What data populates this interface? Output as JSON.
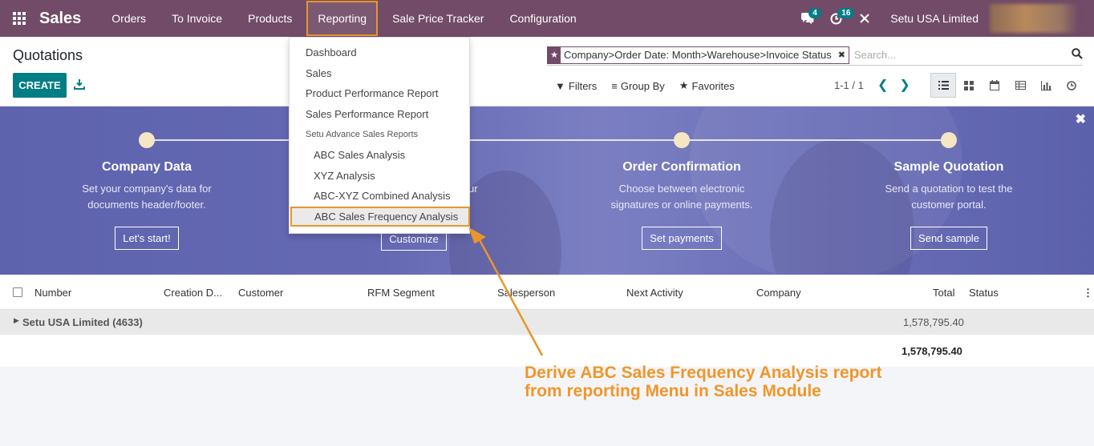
{
  "navbar": {
    "app_name": "Sales",
    "menu": [
      {
        "label": "Orders"
      },
      {
        "label": "To Invoice"
      },
      {
        "label": "Products"
      },
      {
        "label": "Reporting"
      },
      {
        "label": "Sale Price Tracker"
      },
      {
        "label": "Configuration"
      }
    ],
    "messages_count": "4",
    "activities_count": "16",
    "company": "Setu USA Limited"
  },
  "control_panel": {
    "title": "Quotations",
    "create_label": "CREATE",
    "search": {
      "facet": "Company>Order Date: Month>Warehouse>Invoice Status",
      "placeholder": "Search..."
    },
    "filters_label": "Filters",
    "groupby_label": "Group By",
    "favorites_label": "Favorites",
    "pager": "1-1 / 1"
  },
  "banner": {
    "steps": [
      {
        "title": "Company Data",
        "desc_line1": "Set your company's data for",
        "desc_line2": "documents header/footer.",
        "button": "Let's start!"
      },
      {
        "title": "",
        "desc_line1": "",
        "desc_line2": "",
        "button": "Customize"
      },
      {
        "title": "Order Confirmation",
        "desc_line1": "Choose between electronic",
        "desc_line2": "signatures or online payments.",
        "button": "Set payments"
      },
      {
        "title": "Sample Quotation",
        "desc_line1": "Send a quotation to test the",
        "desc_line2": "customer portal.",
        "button": "Send sample"
      }
    ],
    "partial_text": "ur"
  },
  "list": {
    "columns": [
      "Number",
      "Creation D...",
      "Customer",
      "RFM Segment",
      "Salesperson",
      "Next Activity",
      "Company",
      "Total",
      "Status"
    ],
    "group": {
      "label": "Setu USA Limited (4633)",
      "total": "1,578,795.40"
    },
    "grand_total": "1,578,795.40"
  },
  "reporting_menu": {
    "items": [
      "Dashboard",
      "Sales",
      "Product Performance Report",
      "Sales Performance Report"
    ],
    "section_header": "Setu Advance Sales Reports",
    "sub_items": [
      "ABC Sales Analysis",
      "XYZ Analysis",
      "ABC-XYZ Combined Analysis",
      "ABC Sales Frequency Analysis"
    ]
  },
  "annotation": {
    "line1": "Derive ABC Sales Frequency Analysis report",
    "line2": "from reporting Menu in Sales Module",
    "color": "#f0962a"
  },
  "colors": {
    "brand": "#714b67",
    "accent": "#017e84"
  }
}
